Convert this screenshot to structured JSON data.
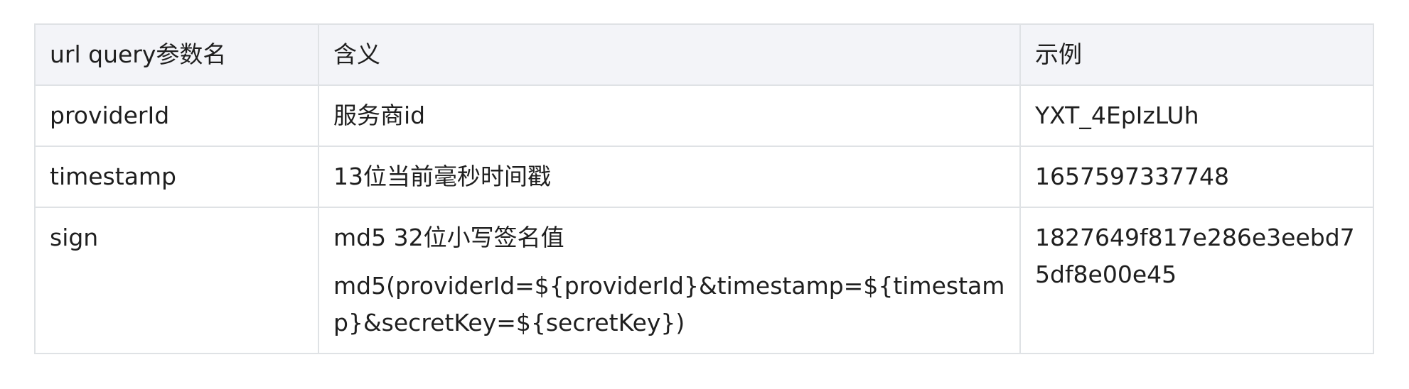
{
  "table": {
    "headers": [
      "url query参数名",
      "含义",
      "示例"
    ],
    "rows": [
      {
        "name": "providerId",
        "meaning": [
          "服务商id"
        ],
        "example": "YXT_4EpIzLUh"
      },
      {
        "name": "timestamp",
        "meaning": [
          "13位当前毫秒时间戳"
        ],
        "example": "1657597337748"
      },
      {
        "name": "sign",
        "meaning": [
          "md5 32位小写签名值",
          "md5(providerId=${providerId}&timestamp=${timestamp}&secretKey=${secretKey})"
        ],
        "example": "1827649f817e286e3eebd75df8e00e45"
      }
    ]
  }
}
